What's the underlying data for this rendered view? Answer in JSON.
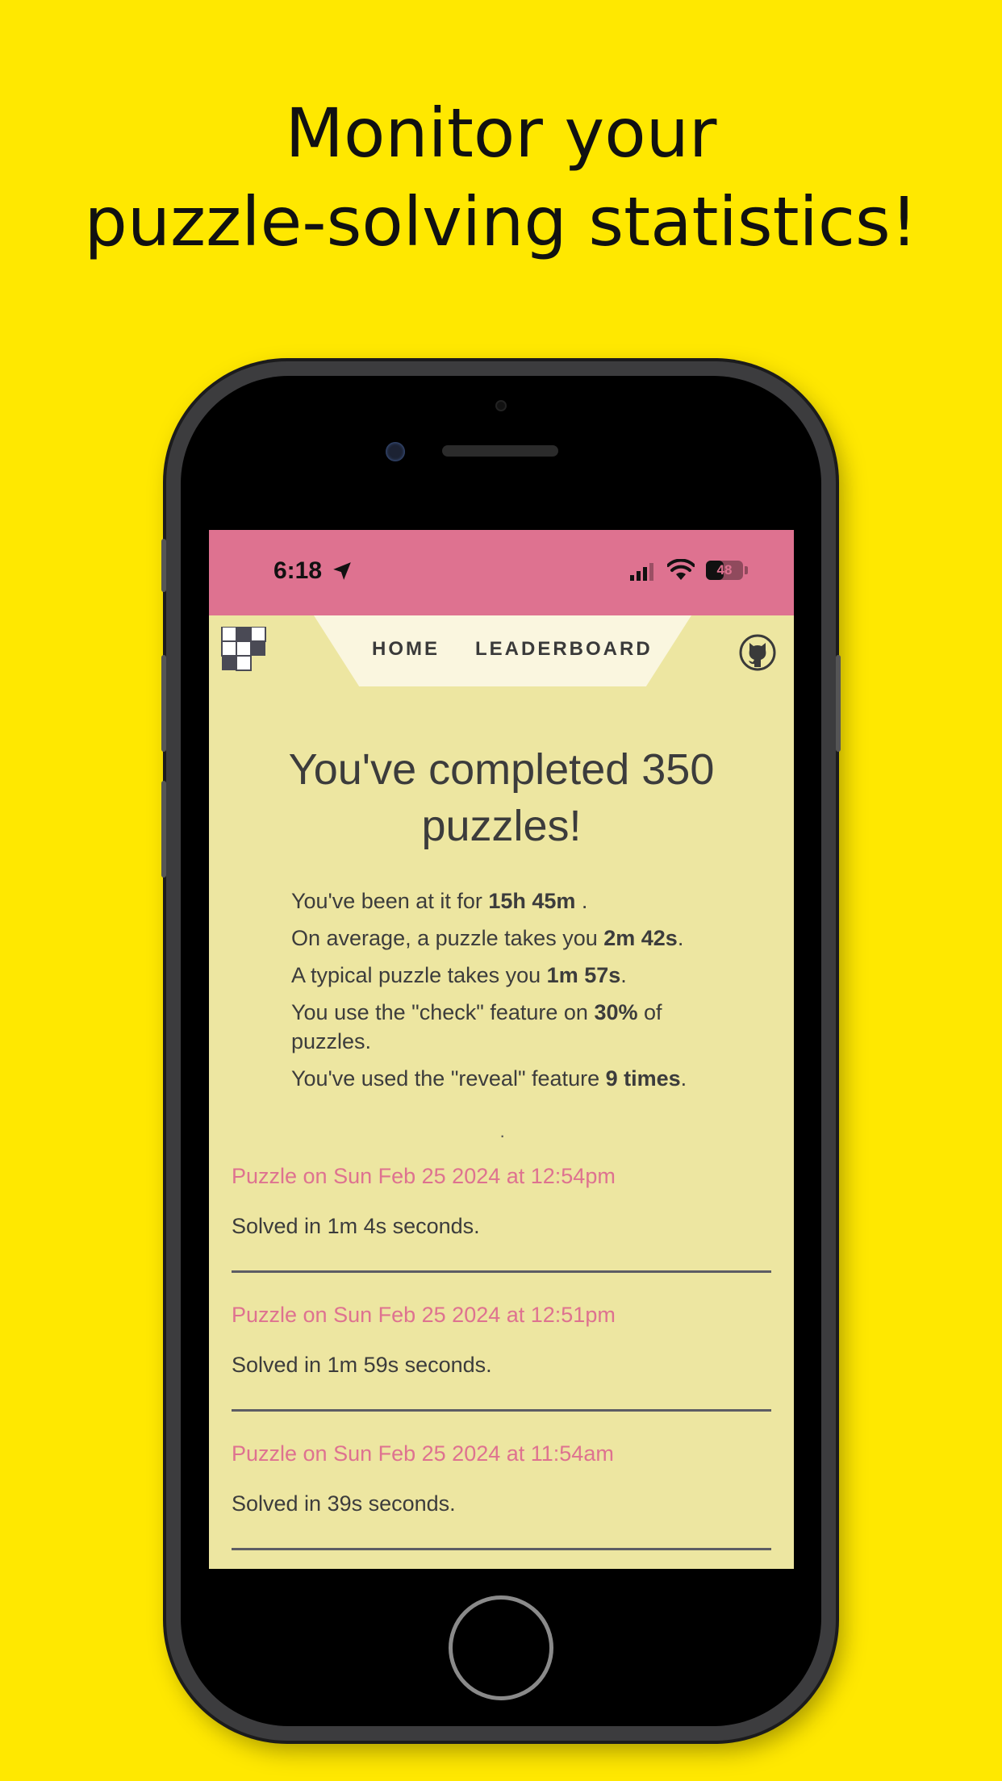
{
  "headline": {
    "line1": "Monitor your",
    "line2": "puzzle-solving statistics!"
  },
  "status_bar": {
    "time": "6:18",
    "battery": "48",
    "battery_level": 0.48
  },
  "nav": {
    "home": "HOME",
    "leaderboard": "LEADERBOARD"
  },
  "summary": {
    "title": "You've completed 350 puzzles!",
    "stats": [
      {
        "pre": "You've been at it for ",
        "value": "15h 45m",
        "post": " ."
      },
      {
        "pre": "On average, a puzzle takes you ",
        "value": "2m 42s",
        "post": "."
      },
      {
        "pre": "A typical puzzle takes you ",
        "value": "1m 57s",
        "post": "."
      },
      {
        "pre": "You use the \"check\" feature on ",
        "value": "30%",
        "post": " of puzzles."
      },
      {
        "pre": "You've used the \"reveal\" feature ",
        "value": "9 times",
        "post": "."
      }
    ]
  },
  "separator": "·",
  "puzzles": [
    {
      "title": "Puzzle on Sun Feb 25 2024 at 12:54pm",
      "solved": "Solved in 1m 4s seconds."
    },
    {
      "title": "Puzzle on Sun Feb 25 2024 at 12:51pm",
      "solved": "Solved in 1m 59s seconds."
    },
    {
      "title": "Puzzle on Sun Feb 25 2024 at 11:54am",
      "solved": "Solved in 39s seconds."
    }
  ],
  "colors": {
    "background": "#FFE800",
    "status_bar": "#DE7290",
    "screen": "#EDE6A1",
    "accent": "#DE7290"
  },
  "icons": {
    "location": "location-arrow-icon",
    "signal": "cellular-signal-icon",
    "wifi": "wifi-icon",
    "battery": "battery-icon",
    "logo": "crossword-logo-icon",
    "github": "github-icon"
  }
}
